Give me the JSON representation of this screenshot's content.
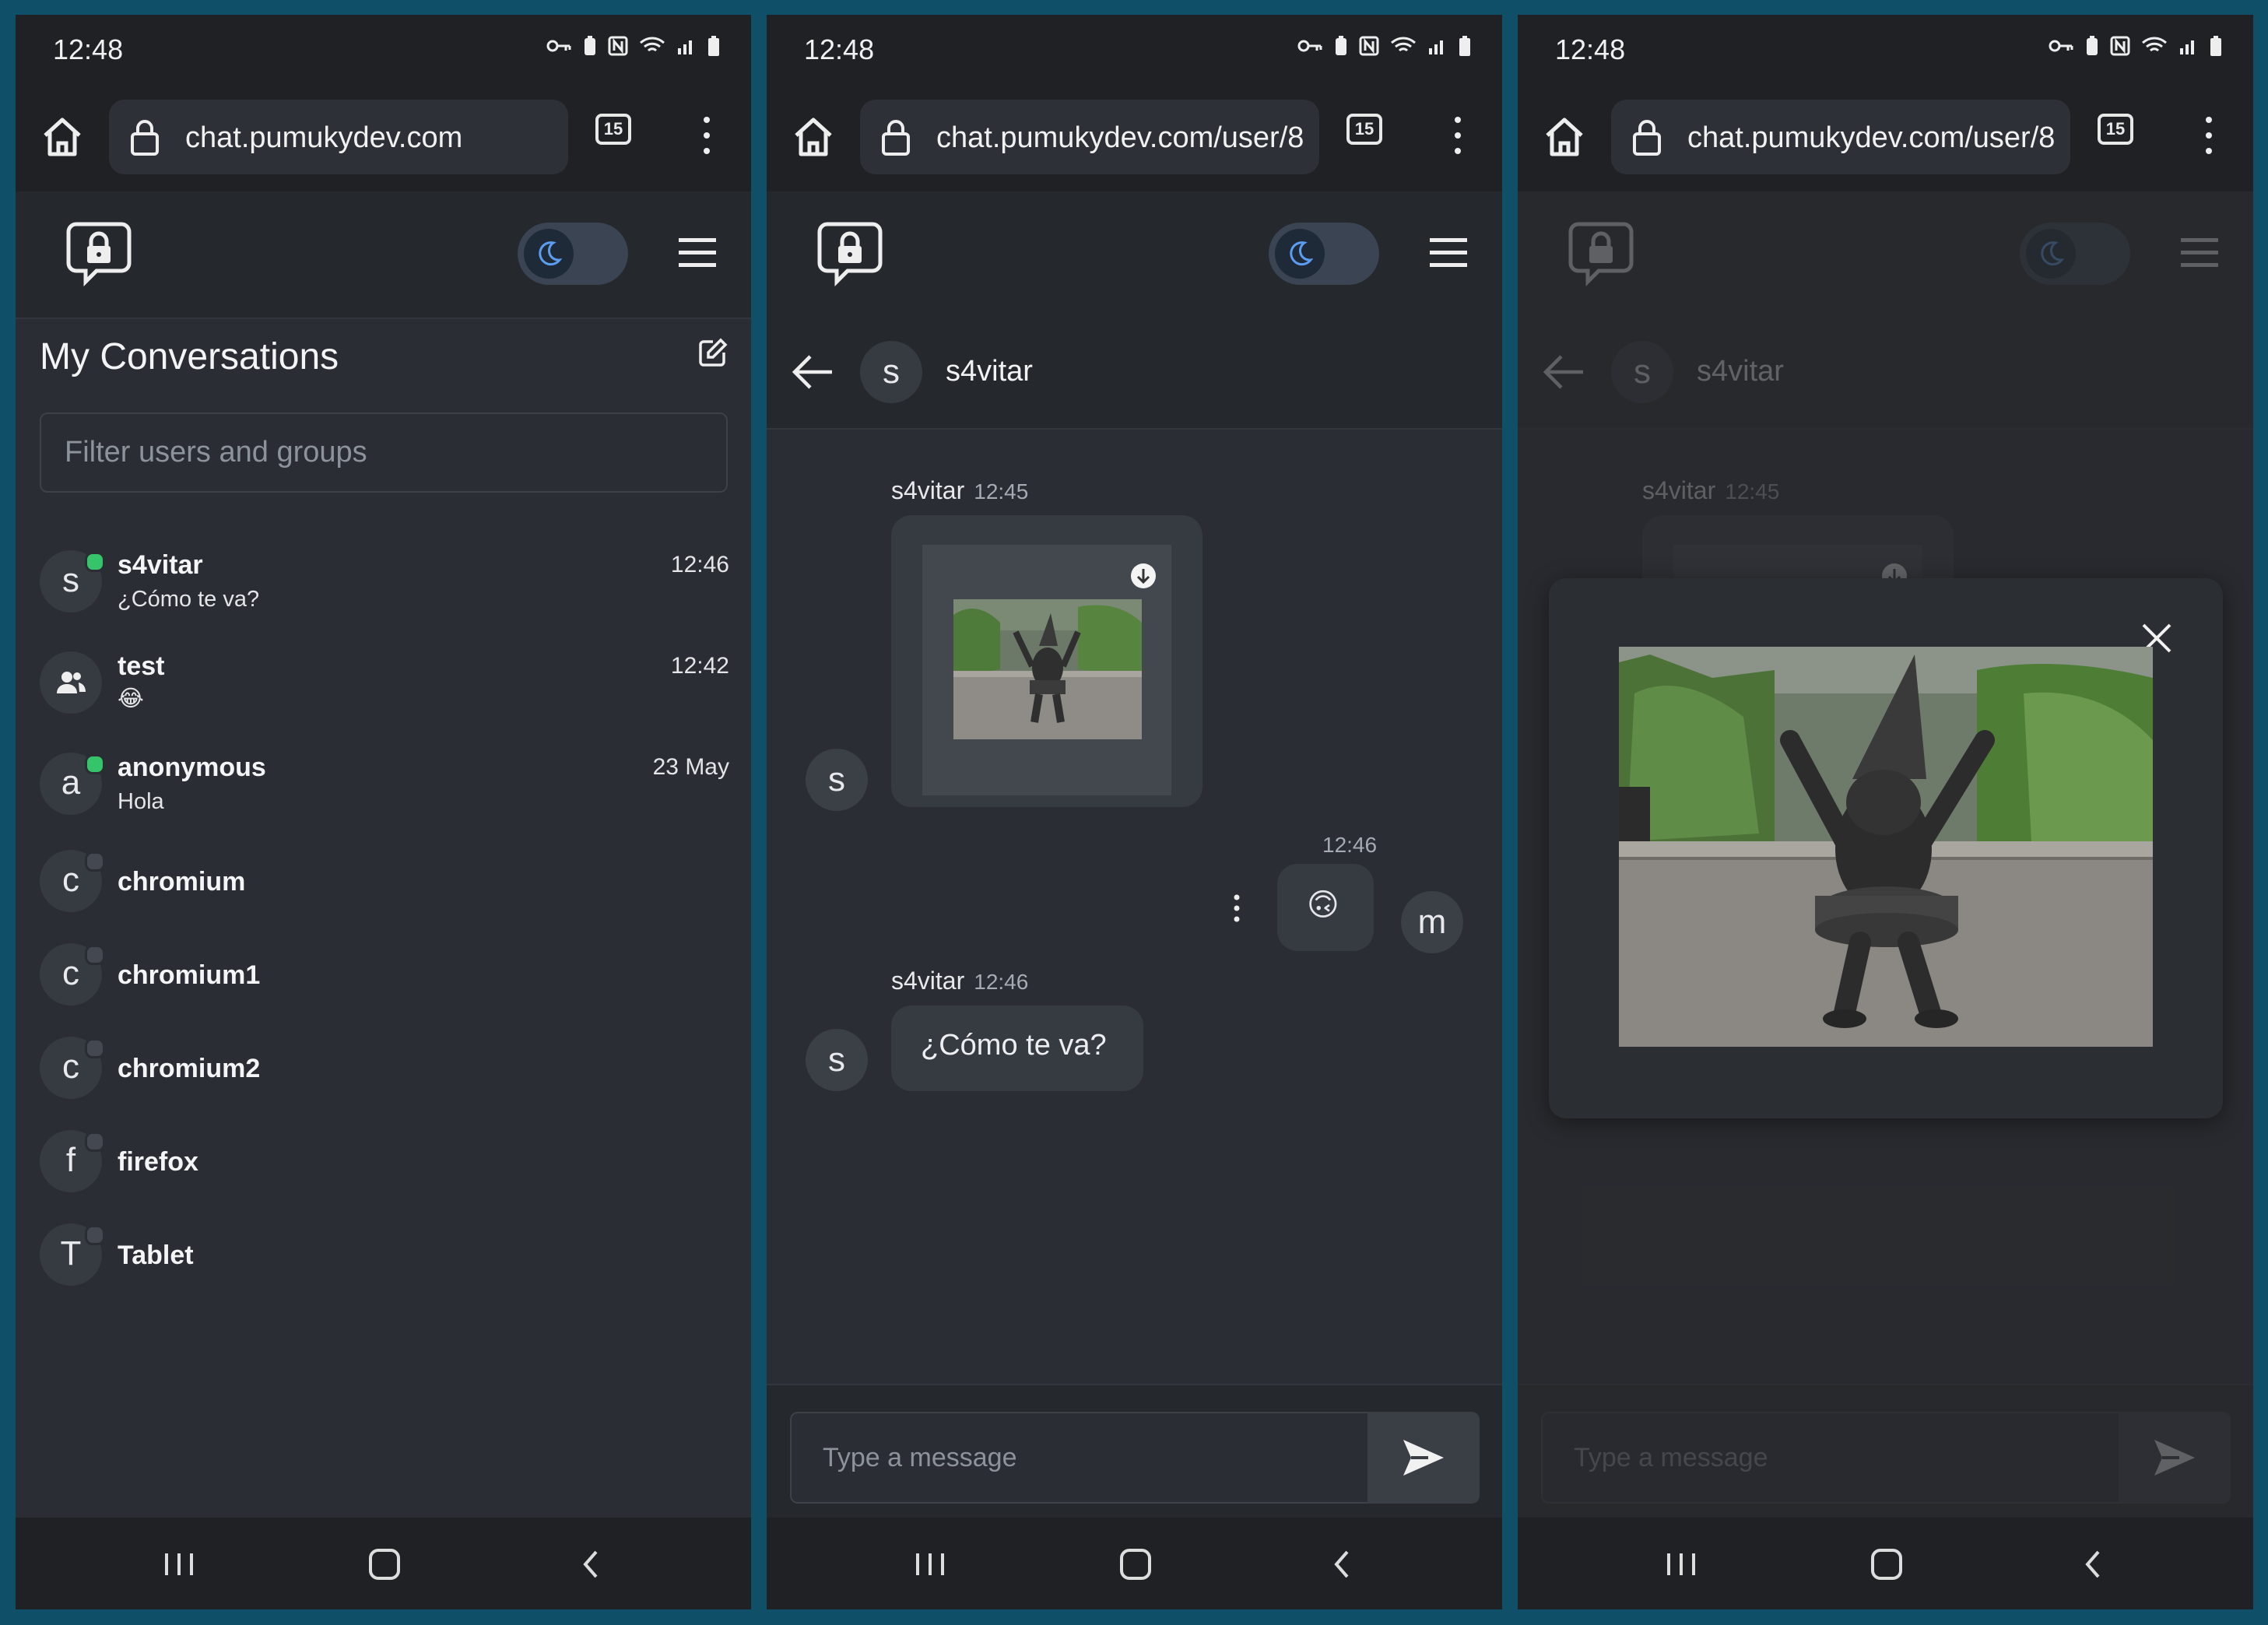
{
  "status_bar": {
    "time": "12:48"
  },
  "browser": {
    "tab_count": "15",
    "url_home": "chat.pumukydev.com",
    "url_user": "chat.pumukydev.com/user/8"
  },
  "conversations": {
    "title": "My Conversations",
    "filter_placeholder": "Filter users and groups",
    "items": [
      {
        "avatar": "s",
        "name": "s4vitar",
        "preview": "¿Cómo te va?",
        "time": "12:46",
        "online": true
      },
      {
        "avatar": "group-icon",
        "name": "test",
        "preview": "😂",
        "time": "12:42",
        "online": false
      },
      {
        "avatar": "a",
        "name": "anonymous",
        "preview": "Hola",
        "time": "23 May",
        "online": true
      },
      {
        "avatar": "c",
        "name": "chromium",
        "preview": "",
        "time": "",
        "online": false
      },
      {
        "avatar": "c",
        "name": "chromium1",
        "preview": "",
        "time": "",
        "online": false
      },
      {
        "avatar": "c",
        "name": "chromium2",
        "preview": "",
        "time": "",
        "online": false
      },
      {
        "avatar": "f",
        "name": "firefox",
        "preview": "",
        "time": "",
        "online": false
      },
      {
        "avatar": "T",
        "name": "Tablet",
        "preview": "",
        "time": "",
        "online": false
      }
    ]
  },
  "chat": {
    "contact_avatar": "s",
    "contact_name": "s4vitar",
    "messages": [
      {
        "sender": "s4vitar",
        "time": "12:45",
        "type": "image",
        "avatar": "s"
      },
      {
        "sender": "",
        "time": "12:46",
        "type": "emoji",
        "text": "🙃",
        "avatar": "m"
      },
      {
        "sender": "s4vitar",
        "time": "12:46",
        "type": "text",
        "text": "¿Cómo te va?",
        "avatar": "s"
      }
    ],
    "input_placeholder": "Type a message"
  },
  "colors": {
    "page_bg": "#0f5068",
    "app_bg": "#2a2d33",
    "header_bg": "#25282d",
    "accent": "#5b9df0",
    "online": "#35c46a"
  }
}
